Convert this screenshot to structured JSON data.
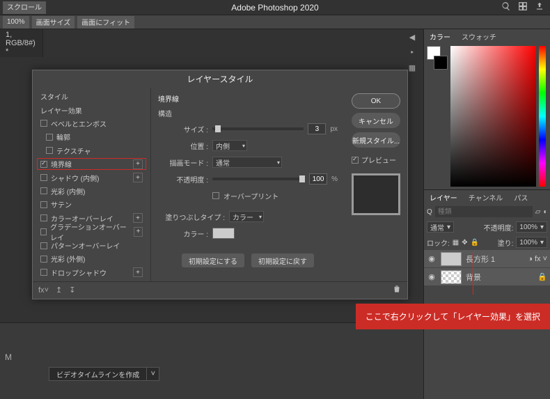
{
  "app_title": "Adobe Photoshop 2020",
  "toolbar": {
    "scroll_label": "スクロール",
    "zoom_value": "100%",
    "fit_screen": "画面サイズ",
    "fit_image": "画面にフィット"
  },
  "doc_tab": "1, RGB/8#) *",
  "timeline": {
    "mode": "M",
    "create_btn": "ビデオタイムラインを作成"
  },
  "right_panel": {
    "color_tabs": {
      "color": "カラー",
      "swatch": "スウォッチ"
    },
    "layer_tabs": {
      "layers": "レイヤー",
      "channels": "チャンネル",
      "paths": "パス"
    },
    "search_placeholder": "種類",
    "blend_mode": "通常",
    "opacity_label": "不透明度:",
    "opacity_value": "100%",
    "lock_label": "ロック:",
    "fill_label": "塗り:",
    "fill_value": "100%",
    "layer1": "長方形 1",
    "layer2": "背景",
    "fx_label": "fx"
  },
  "dialog": {
    "title": "レイヤースタイル",
    "styles_header": "スタイル",
    "blending": "レイヤー効果",
    "items": [
      {
        "label": "ベベルとエンボス",
        "checked": false,
        "plus": false
      },
      {
        "label": "輪郭",
        "checked": false,
        "indent": true
      },
      {
        "label": "テクスチャ",
        "checked": false,
        "indent": true
      },
      {
        "label": "境界線",
        "checked": true,
        "plus": true,
        "selected": true
      },
      {
        "label": "シャドウ (内側)",
        "checked": false,
        "plus": true
      },
      {
        "label": "光彩 (内側)",
        "checked": false
      },
      {
        "label": "サテン",
        "checked": false
      },
      {
        "label": "カラーオーバーレイ",
        "checked": false,
        "plus": true
      },
      {
        "label": "グラデーションオーバーレイ",
        "checked": false,
        "plus": true
      },
      {
        "label": "パターンオーバーレイ",
        "checked": false
      },
      {
        "label": "光彩 (外側)",
        "checked": false
      },
      {
        "label": "ドロップシャドウ",
        "checked": false,
        "plus": true
      }
    ],
    "stroke": {
      "section": "境界線",
      "structure": "構造",
      "size_label": "サイズ :",
      "size_value": "3",
      "size_unit": "px",
      "position_label": "位置 :",
      "position_value": "内側",
      "blend_label": "描画モード :",
      "blend_value": "通常",
      "opacity_label": "不透明度 :",
      "opacity_value": "100",
      "opacity_unit": "%",
      "overprint": "オーバープリント",
      "fill_type_label": "塗りつぶしタイプ :",
      "fill_type_value": "カラー",
      "color_label": "カラー :"
    },
    "buttons": {
      "ok": "OK",
      "cancel": "キャンセル",
      "new_style": "新規スタイル...",
      "preview": "プレビュー"
    },
    "defaults": {
      "make": "初期設定にする",
      "reset": "初期設定に戻す"
    },
    "footer_fx": "fx"
  },
  "callout": "ここで右クリックして「レイヤー効果」を選択"
}
